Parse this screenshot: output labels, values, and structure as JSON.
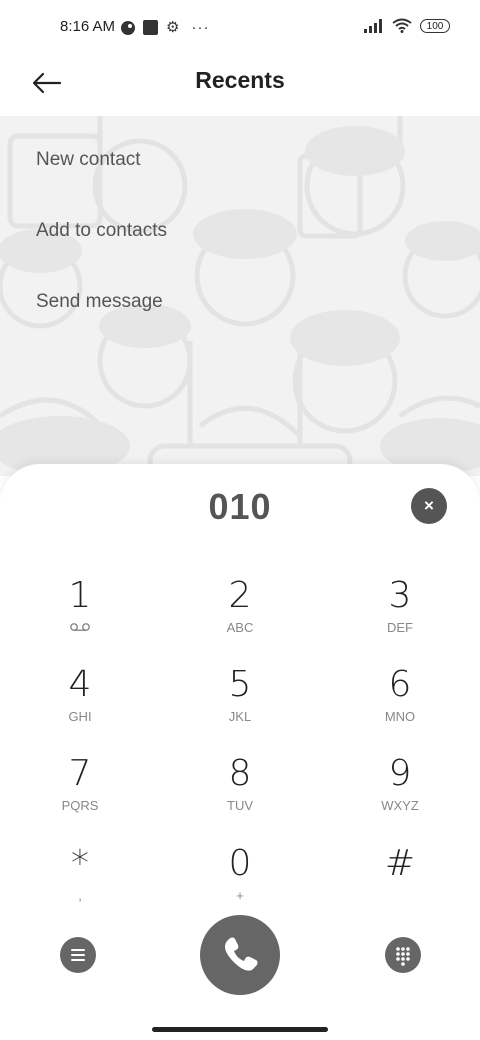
{
  "status_bar": {
    "time": "8:16 AM",
    "more": "···",
    "battery": "100"
  },
  "header": {
    "title": "Recents"
  },
  "menu": {
    "items": [
      "New contact",
      "Add to contacts",
      "Send message"
    ]
  },
  "dialer": {
    "number": "010",
    "clear_label": "×",
    "keys": [
      {
        "digit": "1",
        "letters": ""
      },
      {
        "digit": "2",
        "letters": "ABC"
      },
      {
        "digit": "3",
        "letters": "DEF"
      },
      {
        "digit": "4",
        "letters": "GHI"
      },
      {
        "digit": "5",
        "letters": "JKL"
      },
      {
        "digit": "6",
        "letters": "MNO"
      },
      {
        "digit": "7",
        "letters": "PQRS"
      },
      {
        "digit": "8",
        "letters": "TUV"
      },
      {
        "digit": "9",
        "letters": "WXYZ"
      },
      {
        "digit": "*",
        "letters": ","
      },
      {
        "digit": "0",
        "letters": "+"
      },
      {
        "digit": "#",
        "letters": ""
      }
    ]
  },
  "icons": {
    "back": "back-arrow-icon",
    "voicemail": "voicemail-icon",
    "list": "list-icon",
    "call": "phone-icon",
    "keypad": "keypad-icon"
  }
}
